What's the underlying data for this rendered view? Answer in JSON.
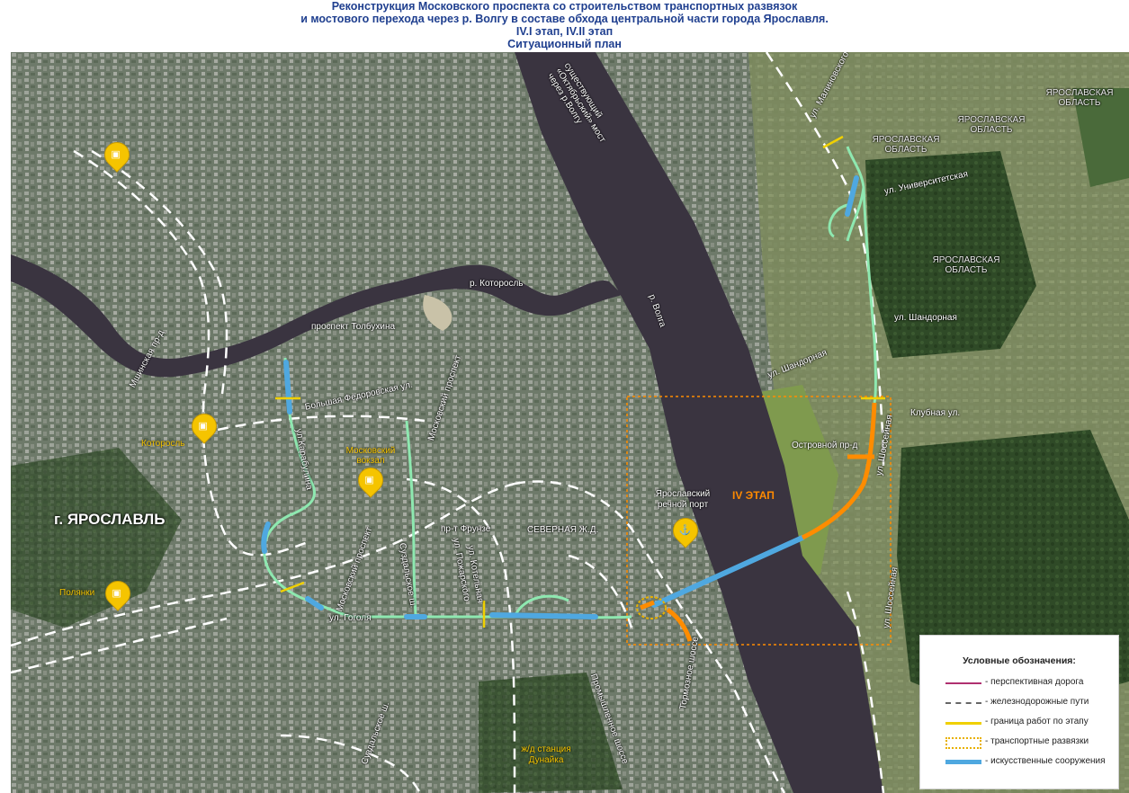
{
  "header": {
    "line1": "Реконструкция Московского проспекта  со строительством транспортных развязок",
    "line2": "и мостового перехода через р. Волгу  в составе обхода центральной части  города Ярославля.",
    "line3": "IV.I этап,    IV.II этап",
    "line4": "Ситуационный план"
  },
  "labels": {
    "bridge": "существующий «Октябрьский» мост через р.Волгу",
    "kotorosl_river": "р. Которосль",
    "volga_river": "р. Волга",
    "tolbukhin": "проспект Толбухина",
    "bolshaya_fedorovskaya": "Большая Федоровская ул.",
    "karabulina": "ул.Карабулина",
    "moskovsky_prospekt_n": "Московский проспект",
    "moskovsky_prospekt_s": "Московский проспект",
    "suzdalskoe_n": "Суздальское ш.",
    "suzdalskoe_s": "Суздальское ш.",
    "frunze": "пр-т Фрунзе",
    "pozharskogo": "ул. Пожарского",
    "kotelnaya": "ул. Котельная",
    "severnaya_zhd": "СЕВЕРНАЯ Ж.Д.",
    "gogolya": "ул. Гоголя",
    "mshinskaya": "Мшинская пр-д",
    "city": "г. ЯРОСЛАВЛЬ",
    "river_port": "Ярославский речной порт",
    "stage4": "IV ЭТАП",
    "ostrovnoy": "Островной пр-д",
    "klubnaya": "Клубная ул.",
    "shandornaya_1": "ул. Шандорная",
    "shandornaya_2": "ул. Шандорная",
    "shosseynaya_1": "ул. Шоссейная",
    "shosseynaya_2": "ул. Шоссейная",
    "universitetskaya": "ул. Университетская",
    "malinovskogo": "ул. Малиновского",
    "region_1": "ЯРОСЛАВСКАЯ ОБЛАСТЬ",
    "region_2": "ЯРОСЛАВСКАЯ ОБЛАСТЬ",
    "region_3": "ЯРОСЛАВСКАЯ ОБЛАСТЬ",
    "region_4": "ЯРОСЛАВСКАЯ ОБЛАСТЬ",
    "tormozneye": "Тормозное шоссе",
    "promyshlennoe": "Промышленное шоссе",
    "kotorosl_station": "Которосль",
    "moskovsky_vokzal": "Московский вокзал",
    "polyanki": "Полянки",
    "dunayka": "ж/д станция Дунайка"
  },
  "legend": {
    "title": "Условные обозначения:",
    "items": [
      {
        "text": "- перспективная дорога",
        "color": "#b03070"
      },
      {
        "text": "- железнодорожные пути",
        "color": "#666666"
      },
      {
        "text": "- граница работ по этапу",
        "color": "#f0d000"
      },
      {
        "text": "- транспортные развязки",
        "color": "#e8b000"
      },
      {
        "text": "- искусственные сооружения",
        "color": "#4fa8e0"
      }
    ]
  },
  "colors": {
    "route_green": "#8ee8b0",
    "route_blue": "#4fa8e0",
    "route_orange": "#ff8c00",
    "river": "#3a3440",
    "boundary": "#f0d000",
    "header_text": "#1f3f8f"
  }
}
